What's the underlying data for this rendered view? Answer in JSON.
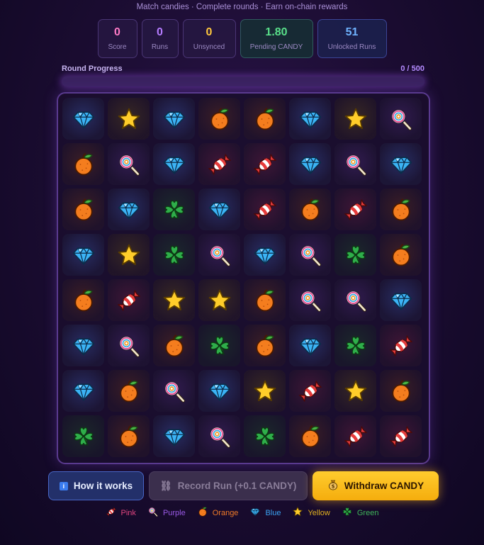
{
  "header": {
    "tagline": "Match candies · Complete rounds · Earn on-chain rewards"
  },
  "stats": [
    {
      "key": "score",
      "value": "0",
      "label": "Score",
      "color": "#ff7ac6"
    },
    {
      "key": "runs",
      "value": "0",
      "label": "Runs",
      "color": "#b57cff"
    },
    {
      "key": "unsynced",
      "value": "0",
      "label": "Unsynced",
      "color": "#ffc83d"
    },
    {
      "key": "pending",
      "value": "1.80",
      "label": "Pending CANDY",
      "color": "#59e08a"
    },
    {
      "key": "unlocked",
      "value": "51",
      "label": "Unlocked Runs",
      "color": "#6fb3ff"
    }
  ],
  "progress": {
    "label": "Round Progress",
    "count": "0 / 500",
    "fraction": 0
  },
  "board": {
    "rows": [
      [
        "blue",
        "yellow",
        "blue",
        "orange",
        "orange",
        "blue",
        "yellow",
        "purple"
      ],
      [
        "orange",
        "purple",
        "blue",
        "pink",
        "pink",
        "blue",
        "purple",
        "blue"
      ],
      [
        "orange",
        "blue",
        "green",
        "blue",
        "pink",
        "orange",
        "pink",
        "orange"
      ],
      [
        "blue",
        "yellow",
        "green",
        "purple",
        "blue",
        "purple",
        "green",
        "orange"
      ],
      [
        "orange",
        "pink",
        "yellow",
        "yellow",
        "orange",
        "purple",
        "purple",
        "blue"
      ],
      [
        "blue",
        "purple",
        "orange",
        "green",
        "orange",
        "blue",
        "green",
        "pink"
      ],
      [
        "blue",
        "orange",
        "purple",
        "blue",
        "yellow",
        "pink",
        "yellow",
        "orange"
      ],
      [
        "green",
        "orange",
        "blue",
        "purple",
        "green",
        "orange",
        "pink",
        "pink"
      ]
    ]
  },
  "buttons": {
    "how": {
      "icon": "i",
      "label": "How it works"
    },
    "record": {
      "icon": "⛓",
      "label": "Record Run (+0.1 CANDY)"
    },
    "withdraw": {
      "icon": "💰",
      "label": "Withdraw CANDY"
    }
  },
  "legend": [
    {
      "type": "pink",
      "label": "Pink",
      "color": "#e0457f"
    },
    {
      "type": "purple",
      "label": "Purple",
      "color": "#9a5ae6"
    },
    {
      "type": "orange",
      "label": "Orange",
      "color": "#f07a28"
    },
    {
      "type": "blue",
      "label": "Blue",
      "color": "#3aa3f2"
    },
    {
      "type": "yellow",
      "label": "Yellow",
      "color": "#e0b020"
    },
    {
      "type": "green",
      "label": "Green",
      "color": "#3fb45a"
    }
  ]
}
